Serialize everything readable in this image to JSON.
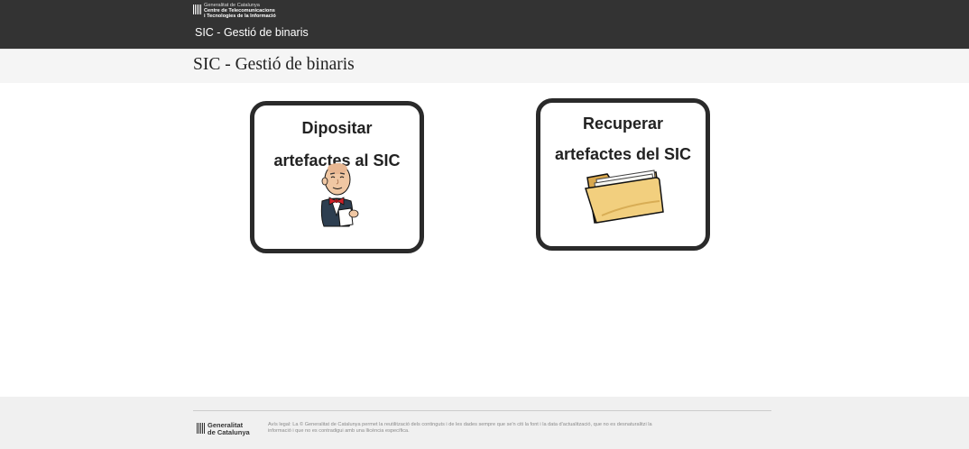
{
  "header": {
    "logo_lines": [
      "Generalitat de Catalunya",
      "Centre de Telecomunicacions",
      "i Tecnologies de la Informació"
    ],
    "app_name": "SIC - Gestió de binaris"
  },
  "page": {
    "title": "SIC - Gestió de binaris"
  },
  "cards": [
    {
      "title_lines": [
        "Dipositar",
        "artefactes al SIC"
      ],
      "icon": "jenkins-butler-icon"
    },
    {
      "title_lines": [
        "Recuperar",
        "artefactes del SIC"
      ],
      "icon": "folder-icon"
    }
  ],
  "footer": {
    "logo_lines": [
      "Generalitat",
      "de Catalunya"
    ],
    "legal_text": "Avís legal: La © Generalitat de Catalunya permet la reutilització dels continguts i de les dades sempre que se'n citi la font i la data d'actualització, que no es desnaturalitzi la informació i que no es contradigui amb una llicència específica."
  },
  "colors": {
    "header_bg": "#333333",
    "title_band_bg": "#f5f5f5",
    "card_border": "#2a2a2a",
    "footer_bg": "#f0f0f0"
  }
}
